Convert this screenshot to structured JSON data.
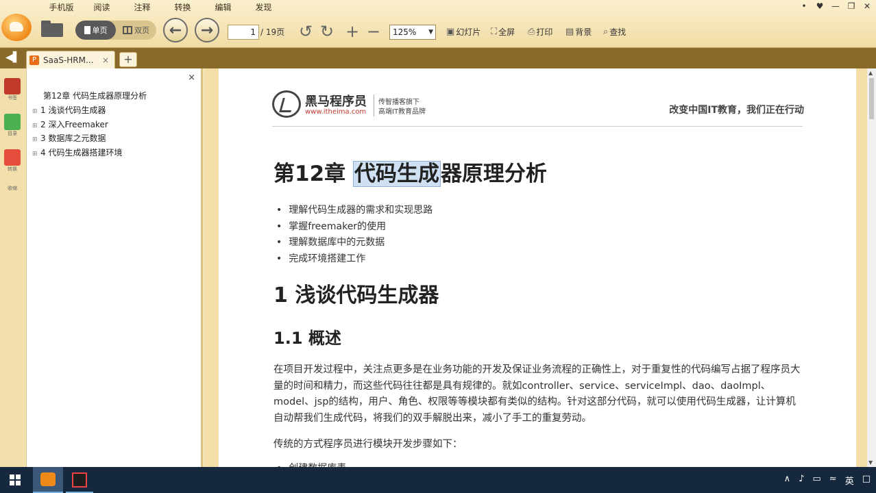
{
  "menu": [
    "手机版",
    "阅读",
    "注释",
    "转换",
    "编辑",
    "发现"
  ],
  "window_controls": [
    "•",
    "♥",
    "—",
    "❐",
    "✕"
  ],
  "toolbar": {
    "view_single": "单页",
    "view_double": "双页",
    "back_glyph": "←",
    "forward_glyph": "→",
    "page_current": "1",
    "page_total": "/ 19页",
    "rotate_left_glyph": "↺",
    "rotate_right_glyph": "↻",
    "zoom_in_glyph": "+",
    "zoom_out_glyph": "−",
    "zoom_value": "125%",
    "slideshow": "幻灯片",
    "fullscreen": "全屏",
    "print": "打印",
    "background": "背景",
    "find": "查找"
  },
  "tabs": [
    {
      "title": "SaaS-HRM...",
      "close": "×"
    }
  ],
  "tab_add": "+",
  "rail": [
    {
      "label": "书签",
      "color": "#c0392b"
    },
    {
      "label": "目录",
      "color": "#4caf50"
    },
    {
      "label": "转换",
      "color": "#e74c3c"
    },
    {
      "label": "收缩",
      "color": ""
    }
  ],
  "outline": {
    "close": "×",
    "root": "第12章 代码生成器原理分析",
    "items": [
      "1 浅谈代码生成器",
      "2 深入Freemaker",
      "3 数据库之元数据",
      "4 代码生成器搭建环境"
    ]
  },
  "doc": {
    "header": {
      "brand": "黑马程序员",
      "url": "www.itheima.com",
      "tagline1": "传智播客旗下",
      "tagline2": "高端IT教育品牌",
      "slogan": "改变中国IT教育，我们正在行动"
    },
    "chapter_prefix": "第12章 ",
    "chapter_highlight": "代码生成",
    "chapter_suffix": "器原理分析",
    "objectives": [
      "理解代码生成器的需求和实现思路",
      "掌握freemaker的使用",
      "理解数据库中的元数据",
      "完成环境搭建工作"
    ],
    "section1": "1 浅谈代码生成器",
    "section1_1": "1.1 概述",
    "paragraph": "在项目开发过程中，关注点更多是在业务功能的开发及保证业务流程的正确性上，对于重复性的代码编写占据了程序员大量的时间和精力，而这些代码往往都是具有规律的。就如controller、service、serviceImpl、dao、daoImpl、model、jsp的结构，用户、角色、权限等等模块都有类似的结构。针对这部分代码，就可以使用代码生成器，让计算机自动帮我们生成代码，将我们的双手解脱出来，减小了手工的重复劳动。",
    "paragraph2": "传统的方式程序员进行模块开发步骤如下：",
    "partial_item": "创建数据库表"
  },
  "taskbar": {
    "tray": [
      "∧",
      "♪",
      "▭",
      "≈",
      "英",
      "□"
    ]
  }
}
